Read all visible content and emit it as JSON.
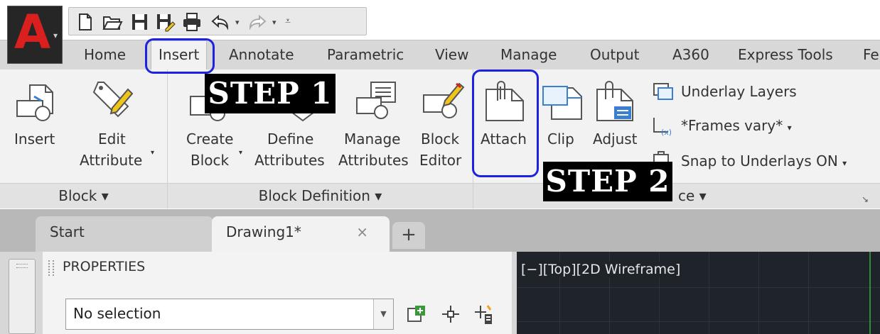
{
  "quick_access": {
    "icons": [
      "new-icon",
      "open-icon",
      "save-icon",
      "save-as-icon",
      "print-icon",
      "undo-icon",
      "redo-icon",
      "customize-icon"
    ]
  },
  "ribbon_tabs": [
    "Home",
    "Insert",
    "Annotate",
    "Parametric",
    "View",
    "Manage",
    "Output",
    "A360",
    "Express Tools",
    "Fe"
  ],
  "active_tab": "Insert",
  "panels": {
    "block": {
      "title": "Block ▾",
      "insert_label": "Insert",
      "edit_attribute_label_1": "Edit",
      "edit_attribute_label_2": "Attribute"
    },
    "block_definition": {
      "title": "Block Definition ▾",
      "create_block_1": "Create",
      "create_block_2": "Block",
      "define_attributes_1": "Define",
      "define_attributes_2": "Attributes",
      "manage_attributes_1": "Manage",
      "manage_attributes_2": "Attributes",
      "block_editor_1": "Block",
      "block_editor_2": "Editor"
    },
    "reference": {
      "title_fragment": "ce ▾",
      "attach_label": "Attach",
      "clip_label": "Clip",
      "adjust_label": "Adjust",
      "underlay_layers_label": "Underlay Layers",
      "frames_vary_label": "*Frames vary*",
      "snap_to_underlays_label": "Snap to Underlays ON"
    }
  },
  "annotations": {
    "step1": "STEP 1",
    "step2": "STEP 2"
  },
  "file_tabs": {
    "start": "Start",
    "drawing": "Drawing1*",
    "close_symbol": "×",
    "add_symbol": "+"
  },
  "properties": {
    "title": "PROPERTIES",
    "selection_value": "No selection"
  },
  "viewport": {
    "label": "[−][Top][2D Wireframe]"
  },
  "colors": {
    "highlight": "#1d22e0",
    "logo_red": "#d9201f",
    "viewport_bg": "#1f232a"
  }
}
